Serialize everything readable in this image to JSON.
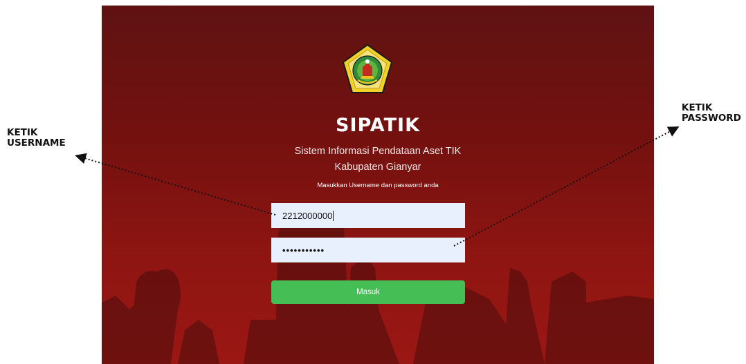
{
  "app": {
    "title": "SIPATIK",
    "subtitle_line1": "Sistem Informasi Pendataan Aset TIK",
    "subtitle_line2": "Kabupaten Gianyar",
    "instruction": "Masukkan Username dan password anda"
  },
  "form": {
    "username_value": "2212000000",
    "password_masked": "•••••••••••",
    "submit_label": "Masuk"
  },
  "annotations": {
    "username_line1": "KETIK",
    "username_line2": "USERNAME",
    "password_line1": "KETIK",
    "password_line2": "PASSWORD"
  },
  "colors": {
    "background_top": "#5f1212",
    "background_bottom": "#9b1713",
    "field_background": "#e8f0fe",
    "button_green": "#44be55"
  }
}
